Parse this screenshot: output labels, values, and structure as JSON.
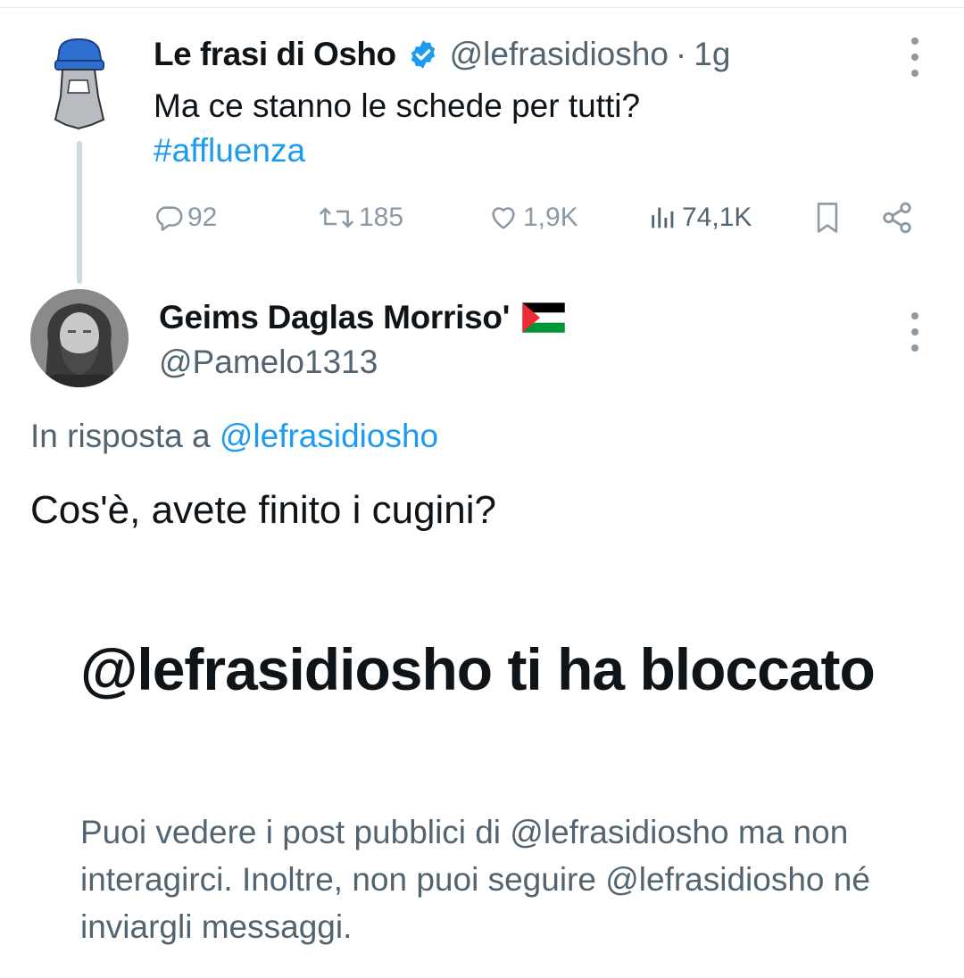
{
  "original_tweet": {
    "author_name": "Le frasi di Osho",
    "handle": "@lefrasidiosho",
    "separator": "·",
    "time": "1g",
    "text": "Ma ce stanno le schede per tutti?",
    "hashtag": "#affluenza",
    "stats": {
      "replies": "92",
      "retweets": "185",
      "likes": "1,9K",
      "views": "74,1K"
    }
  },
  "reply_tweet": {
    "author_name": "Geims Daglas Morriso'",
    "handle": "@Pamelo1313",
    "reply_to_prefix": "In risposta a",
    "reply_to_handle": "@lefrasidiosho",
    "text": "Cos'è, avete finito i cugini?"
  },
  "blocked_notice": {
    "title": "@lefrasidiosho ti ha bloccato",
    "description": "Puoi vedere i post pubblici di @lefrasidiosho ma non interagirci. Inoltre, non puoi seguire @lefrasidiosho né inviargli messaggi."
  },
  "icons": {
    "verified": "verified-badge-icon",
    "more": "more-options-icon",
    "reply": "reply-icon",
    "retweet": "retweet-icon",
    "like": "heart-icon",
    "views": "views-chart-icon",
    "bookmark": "bookmark-icon",
    "share": "share-icon",
    "flag": "palestine-flag-icon"
  },
  "colors": {
    "link": "#1d9bf0",
    "secondary_text": "#536471",
    "primary_text": "#0f1419",
    "icon_gray": "#8b98a5",
    "thread_line": "#cfd9de"
  }
}
